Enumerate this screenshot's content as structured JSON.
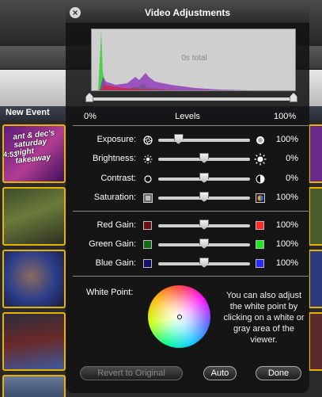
{
  "background": {
    "event_label": "New Event",
    "clip_duration": "4:53",
    "clip_title": "ant & dec's saturday night takeaway"
  },
  "hud": {
    "title": "Video Adjustments",
    "histogram_total": "0s total",
    "levels": {
      "label": "Levels",
      "min_label": "0%",
      "max_label": "100%",
      "low": 0.0,
      "high": 1.0
    },
    "adjustments": [
      {
        "label": "Exposure:",
        "value": "100%",
        "icon_left": "aperture-icon",
        "icon_right": "exposure-circle-icon",
        "position": 0.22
      },
      {
        "label": "Brightness:",
        "value": "0%",
        "icon_left": "sun-small-icon",
        "icon_right": "sun-large-icon",
        "position": 0.5
      },
      {
        "label": "Contrast:",
        "value": "0%",
        "icon_left": "circle-outline-icon",
        "icon_right": "contrast-icon",
        "position": 0.5
      },
      {
        "label": "Saturation:",
        "value": "100%",
        "icon_left": "gray-swatch-icon",
        "icon_right": "color-swatch-icon",
        "position": 0.5
      }
    ],
    "gains": [
      {
        "label": "Red Gain:",
        "value": "100%",
        "dim_color": "#6b1010",
        "bright_color": "#ff2a2a",
        "position": 0.5
      },
      {
        "label": "Green Gain:",
        "value": "100%",
        "dim_color": "#126b12",
        "bright_color": "#22e822",
        "position": 0.5
      },
      {
        "label": "Blue Gain:",
        "value": "100%",
        "dim_color": "#12126b",
        "bright_color": "#2a2aff",
        "position": 0.5
      }
    ],
    "white_point": {
      "label": "White Point:",
      "description": "You can also adjust the white point by clicking on a white or gray area of the viewer."
    },
    "buttons": {
      "revert": "Revert to Original",
      "auto": "Auto",
      "done": "Done"
    }
  }
}
